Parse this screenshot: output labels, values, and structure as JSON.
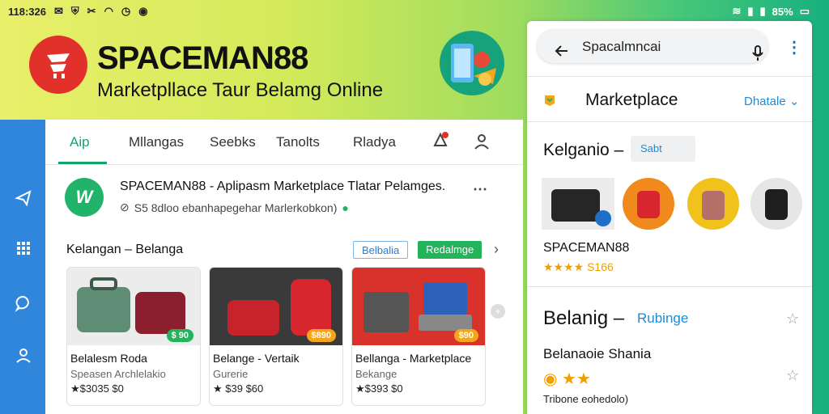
{
  "statusbar": {
    "time": "118:326",
    "battery": "85%"
  },
  "brand": {
    "name": "SPACEMAN88",
    "tagline": "Marketpllace Taur Belamg Online"
  },
  "nav": {
    "items": [
      "Aip",
      "Mllangas",
      "Seebks",
      "Tanolts",
      "Rladya"
    ]
  },
  "app": {
    "title": "SPACEMAN88 - Aplipasm Marketplace Tlatar Pelamges.",
    "subtitle": "S5 8dloo ebanhapegehar Marlerkobkon)",
    "logo_text": "W"
  },
  "section": {
    "title": "Kelangan – Belanga",
    "pill_outline": "Belbalia",
    "pill_fill": "Redalmge"
  },
  "cards": [
    {
      "title": "Belalesm Roda",
      "sub": "Speasen Archlelakio",
      "rating": "★$3035 $0",
      "price": "$ 90",
      "price_color": "#23b35a"
    },
    {
      "title": "Belange - Vertaik",
      "sub": "Gurerie",
      "rating": "★ $39 $60",
      "price": "$890",
      "price_color": "#f5a51c"
    },
    {
      "title": "Bellanga - Marketplace",
      "sub": "Bekange",
      "rating": "★$393 $0",
      "price": "$90",
      "price_color": "#f5a51c"
    }
  ],
  "phone": {
    "search_value": "Spacalmncai",
    "marketplace_title": "Marketplace",
    "marketplace_link": "Dhatale",
    "category_title": "Kelganio –",
    "category_chip": "Sabt",
    "seller_name": "SPACEMAN88",
    "seller_rating": "★★★★ S166",
    "b2_title": "Belanig –",
    "b2_link": "Rubinge",
    "b3_title": "Belanaoie Shania",
    "b3_stars": "★★",
    "b3_sub": "Tribone eohedolo)"
  },
  "colors": {
    "accent_green": "#14a36b",
    "rail_blue": "#2f86db",
    "brand_red": "#e2312a",
    "link_blue": "#1d8bd6"
  }
}
